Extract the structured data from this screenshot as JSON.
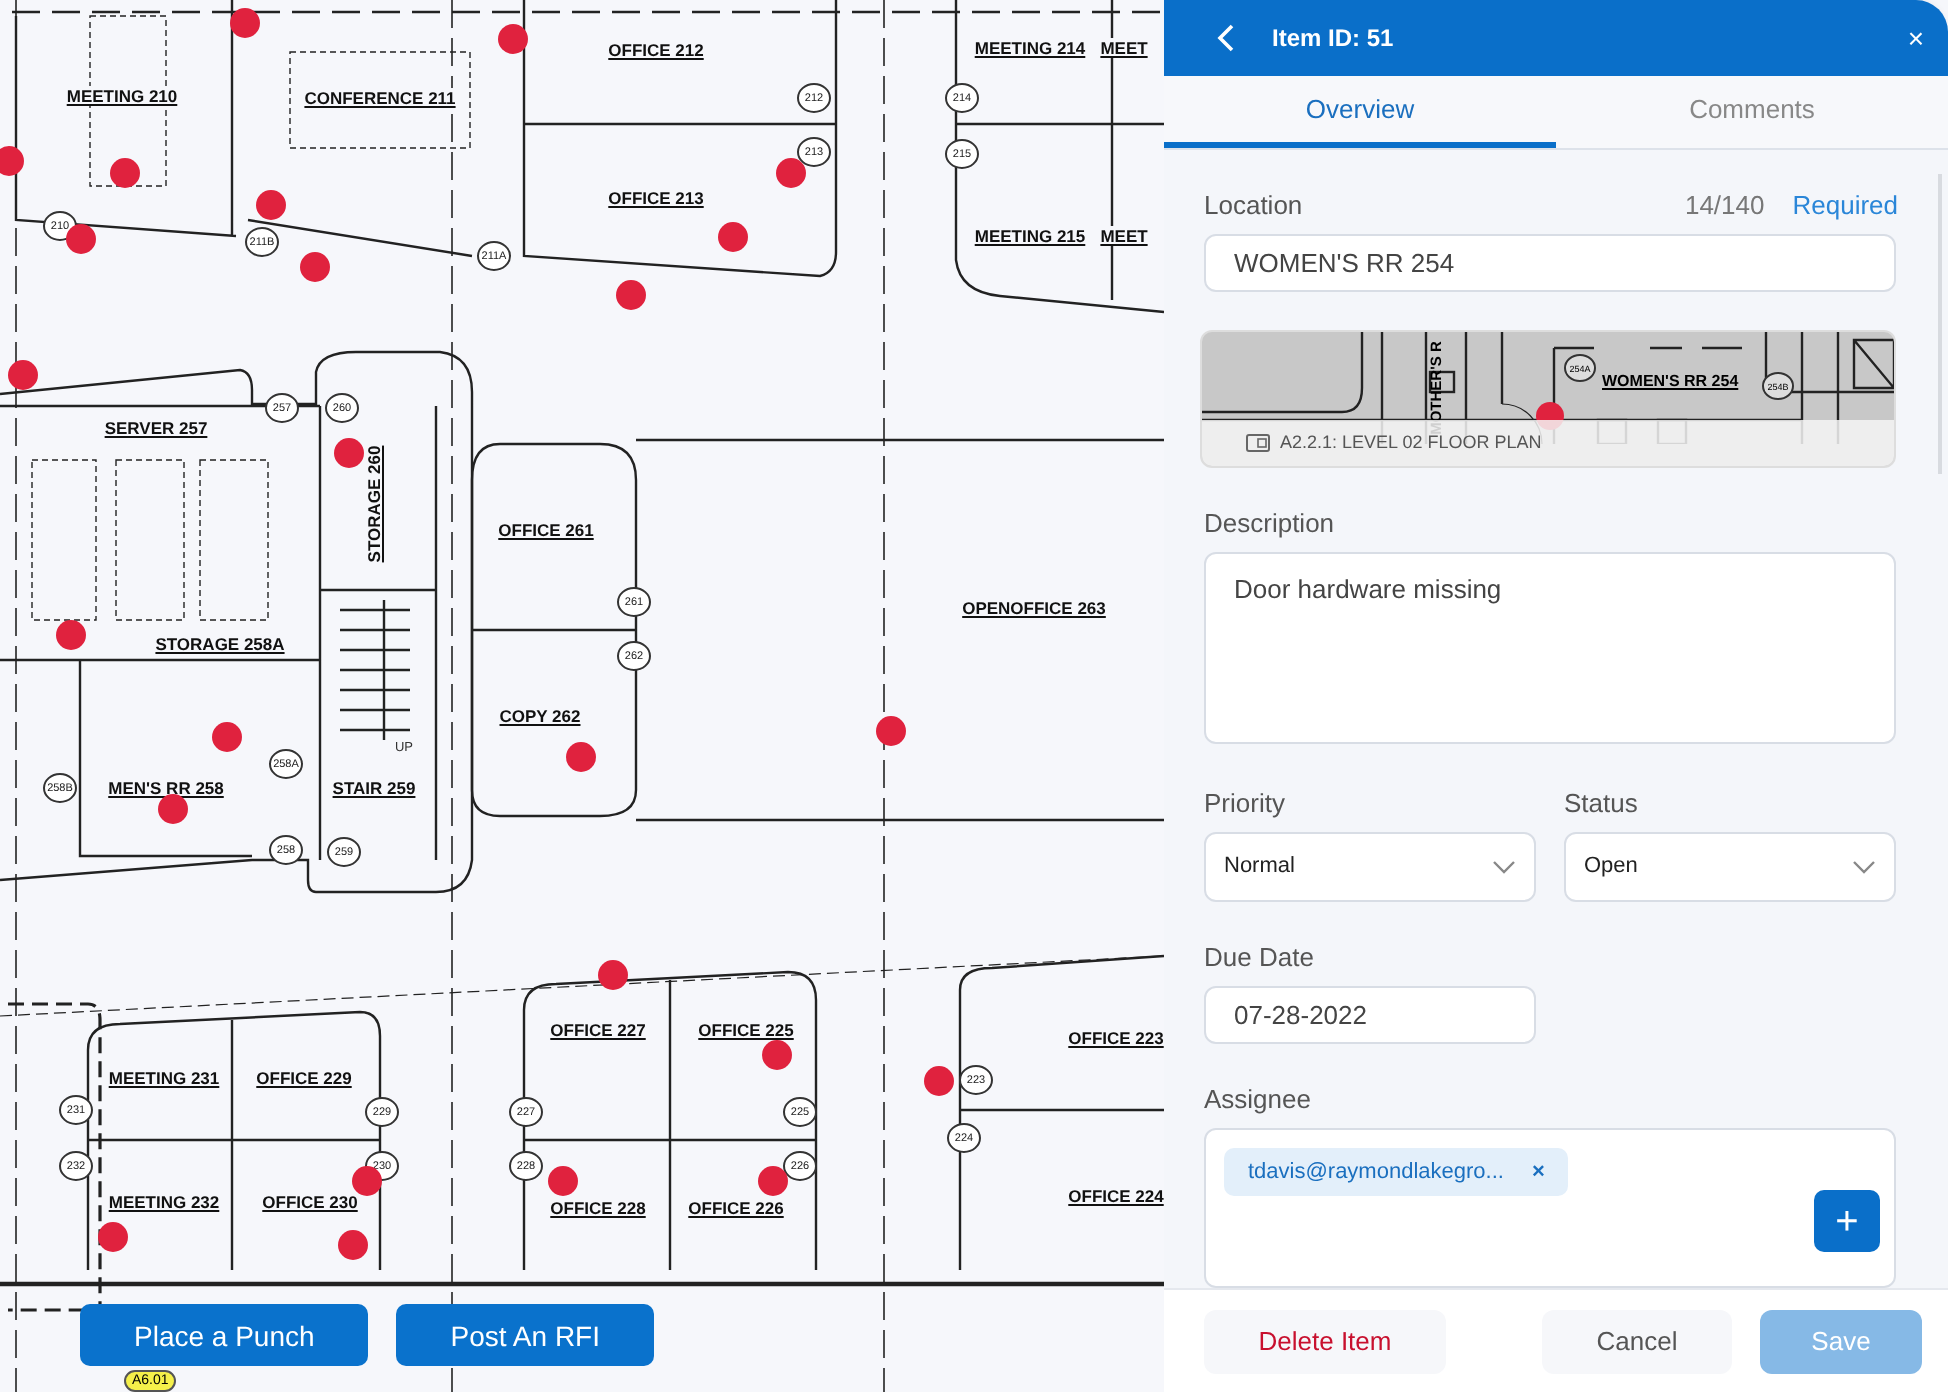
{
  "floor_plan": {
    "rooms": [
      {
        "label": "MEETING 210",
        "kind": "room"
      },
      {
        "label": "CONFERENCE 211",
        "kind": "room"
      },
      {
        "label": "OFFICE 212",
        "kind": "room"
      },
      {
        "label": "OFFICE 213",
        "kind": "room"
      },
      {
        "label": "MEETING 214",
        "kind": "room"
      },
      {
        "label": "MEET",
        "kind": "room"
      },
      {
        "label": "MEETING 215",
        "kind": "room"
      },
      {
        "label": "MEET",
        "kind": "room"
      },
      {
        "label": "SERVER 257",
        "kind": "room"
      },
      {
        "label": "STORAGE 260",
        "kind": "vertical"
      },
      {
        "label": "OFFICE 261",
        "kind": "room"
      },
      {
        "label": "OPENOFFICE 263",
        "kind": "room"
      },
      {
        "label": "STORAGE 258A",
        "kind": "room"
      },
      {
        "label": "COPY 262",
        "kind": "room"
      },
      {
        "label": "MEN'S RR 258",
        "kind": "room"
      },
      {
        "label": "UP",
        "kind": "note"
      },
      {
        "label": "STAIR 259",
        "kind": "room"
      },
      {
        "label": "MEETING 231",
        "kind": "room"
      },
      {
        "label": "OFFICE 229",
        "kind": "room"
      },
      {
        "label": "OFFICE 227",
        "kind": "room"
      },
      {
        "label": "OFFICE 225",
        "kind": "room"
      },
      {
        "label": "OFFICE 223",
        "kind": "room"
      },
      {
        "label": "MEETING 232",
        "kind": "room"
      },
      {
        "label": "OFFICE 230",
        "kind": "room"
      },
      {
        "label": "OFFICE 228",
        "kind": "room"
      },
      {
        "label": "OFFICE 226",
        "kind": "room"
      },
      {
        "label": "OFFICE 224",
        "kind": "room"
      }
    ],
    "door_tags": [
      "210",
      "211B",
      "211A",
      "212",
      "213",
      "214",
      "215",
      "257",
      "260",
      "261",
      "262",
      "258A",
      "258B",
      "258",
      "259",
      "231",
      "232",
      "229",
      "230",
      "227",
      "228",
      "225",
      "226",
      "223",
      "224"
    ],
    "sheet_tag": "A6.01"
  },
  "actions": [
    "Place a Punch",
    "Post An RFI"
  ],
  "panel": {
    "title": "Item ID: 51",
    "close": "×",
    "tabs": [
      {
        "label": "Overview",
        "selected": true
      },
      {
        "label": "Comments",
        "selected": false
      }
    ],
    "location": {
      "label": "Location",
      "counter": "14/140",
      "required": "Required",
      "value": "WOMEN'S RR 254"
    },
    "thumbnail": {
      "room": "WOMEN'S RR 254",
      "side_room": "MOTHER'S R",
      "tags": [
        "254A",
        "254B"
      ],
      "sheet": "A2.2.1: LEVEL 02 FLOOR PLAN"
    },
    "description": {
      "label": "Description",
      "value": "Door hardware missing"
    },
    "priority": {
      "label": "Priority",
      "value": "Normal"
    },
    "status": {
      "label": "Status",
      "value": "Open"
    },
    "due_date": {
      "label": "Due Date",
      "value": "07-28-2022"
    },
    "assignee": {
      "label": "Assignee",
      "chips": [
        {
          "label": "tdavis@raymondlakegro...",
          "remove": "×"
        }
      ],
      "add": "+"
    },
    "footer": [
      {
        "label": "Delete Item",
        "kind": "danger",
        "disabled": false
      },
      {
        "label": "Cancel",
        "kind": "plain",
        "disabled": false
      },
      {
        "label": "Save",
        "kind": "primary",
        "disabled": true
      }
    ]
  }
}
